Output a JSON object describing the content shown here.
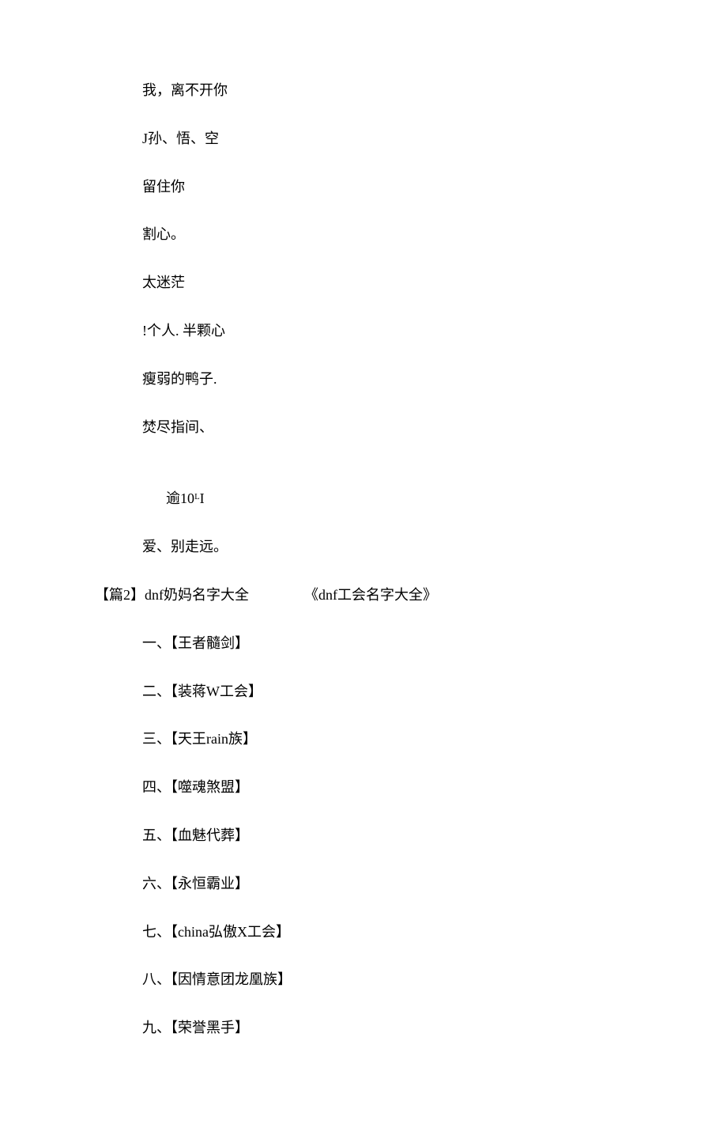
{
  "names_section1": [
    "我，离不开你",
    "J孙、悟、空",
    "留住你",
    "割心。",
    "太迷茫",
    "!个人. 半颗心",
    "瘦弱的鸭子.",
    "焚尽指间、"
  ],
  "middle_line": "逾10ᴸI",
  "names_section1b": "爱、别走远。",
  "section2_header_left": "【篇2】dnf奶妈名字大全",
  "section2_header_right": "《dnf工会名字大全》",
  "guild_names": [
    "一、【王者髓剑】",
    "二、【装蒋W工会】",
    "三、【天王rain族】",
    "四、【噬魂煞盟】",
    "五、【血魅代葬】",
    "六、【永恒霸业】",
    "七、【china弘傲X工会】",
    "八、【因情意团龙凰族】",
    "九、【荣誉黑手】"
  ]
}
